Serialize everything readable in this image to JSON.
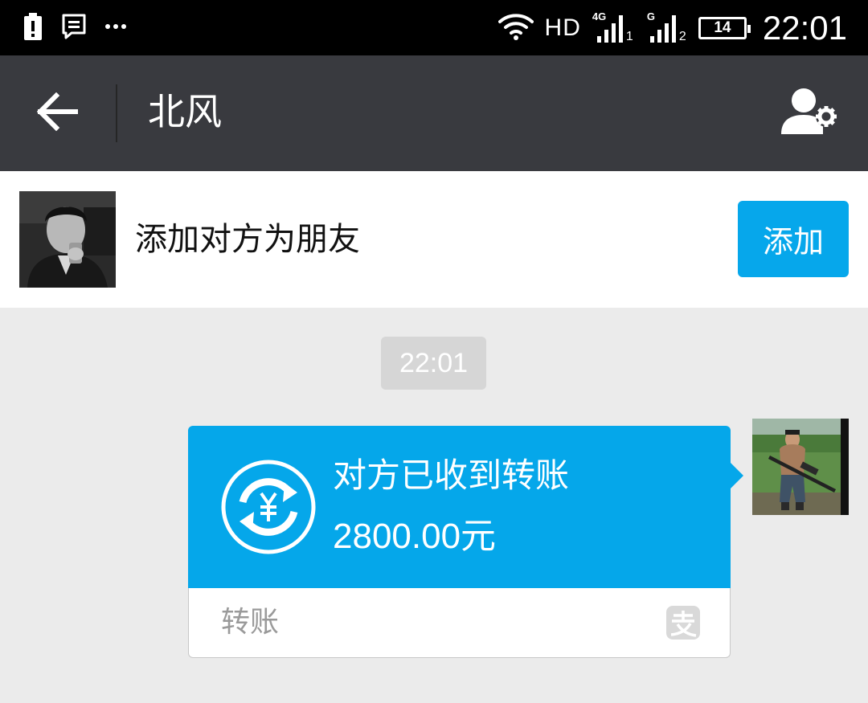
{
  "status_bar": {
    "network": "HD",
    "sim1_tag": "4G",
    "sim1_index": "1",
    "sim2_tag": "G",
    "sim2_index": "2",
    "battery": "14",
    "time": "22:01"
  },
  "header": {
    "title": "北风"
  },
  "banner": {
    "text": "添加对方为朋友",
    "add_label": "添加"
  },
  "chat": {
    "timestamp": "22:01",
    "transfer": {
      "status": "对方已收到转账",
      "amount": "2800.00元",
      "footer_label": "转账"
    }
  },
  "colors": {
    "accent": "#06a7eb",
    "title_bar": "#393a3f",
    "chat_background": "#ebebeb"
  }
}
